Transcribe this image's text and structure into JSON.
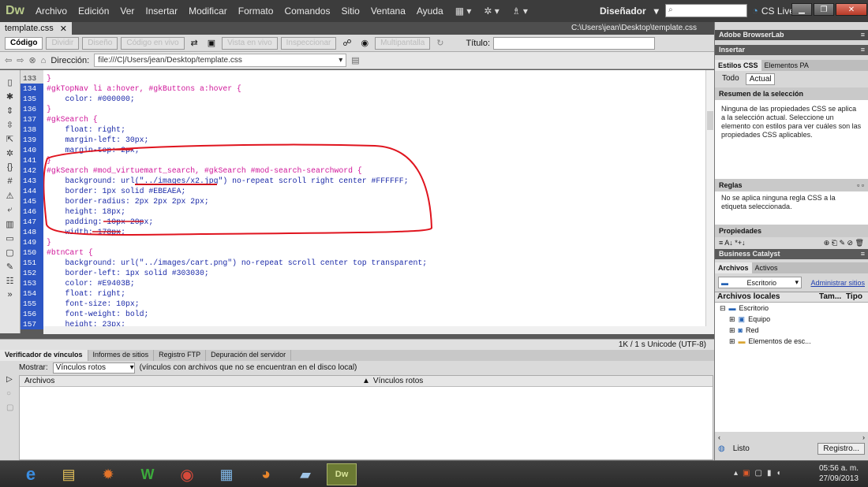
{
  "menubar": {
    "logo": "Dw",
    "items": [
      "Archivo",
      "Edición",
      "Ver",
      "Insertar",
      "Modificar",
      "Formato",
      "Comandos",
      "Sitio",
      "Ventana",
      "Ayuda"
    ],
    "workspace": "Diseñador",
    "cslive": "CS Live"
  },
  "document": {
    "tab_label": "template.css",
    "path": "C:\\Users\\jean\\Desktop\\template.css",
    "view_buttons": [
      "Código",
      "Dividir",
      "Diseño",
      "Código en vivo",
      "Vista en vivo",
      "Inspeccionar",
      "Multipantalla"
    ],
    "title_label": "Título:",
    "address_label": "Dirección:",
    "address_value": "file:///C|/Users/jean/Desktop/template.css",
    "status": "1K / 1 s  Unicode (UTF-8)"
  },
  "code": {
    "lines": [
      {
        "n": "133",
        "t": "}",
        "c": "sel"
      },
      {
        "n": "134",
        "t": "#gkTopNav li a:hover, #gkButtons a:hover {",
        "c": "sel"
      },
      {
        "n": "135",
        "t": "    color: #000000;",
        "c": "prop"
      },
      {
        "n": "136",
        "t": "}",
        "c": "sel"
      },
      {
        "n": "137",
        "t": "#gkSearch {",
        "c": "sel"
      },
      {
        "n": "138",
        "t": "    float: right;",
        "c": "prop"
      },
      {
        "n": "139",
        "t": "    margin-left: 30px;",
        "c": "prop"
      },
      {
        "n": "140",
        "t": "    margin-top: 2px;",
        "c": "prop"
      },
      {
        "n": "141",
        "t": "}",
        "c": "sel"
      },
      {
        "n": "142",
        "t": "#gkSearch #mod_virtuemart_search, #gkSearch #mod-search-searchword {",
        "c": "sel"
      },
      {
        "n": "143",
        "t": "    background: url(\"../images/x2.jpg\") no-repeat scroll right center #FFFFFF;",
        "c": "prop"
      },
      {
        "n": "144",
        "t": "    border: 1px solid #EBEAEA;",
        "c": "prop"
      },
      {
        "n": "145",
        "t": "    border-radius: 2px 2px 2px 2px;",
        "c": "prop"
      },
      {
        "n": "146",
        "t": "    height: 18px;",
        "c": "prop"
      },
      {
        "n": "147",
        "t": "    padding: 10px 20px;",
        "c": "prop"
      },
      {
        "n": "148",
        "t": "    width: 178px;",
        "c": "prop"
      },
      {
        "n": "149",
        "t": "}",
        "c": "sel"
      },
      {
        "n": "150",
        "t": "#btnCart {",
        "c": "sel"
      },
      {
        "n": "151",
        "t": "    background: url(\"../images/cart.png\") no-repeat scroll center top transparent;",
        "c": "prop"
      },
      {
        "n": "152",
        "t": "    border-left: 1px solid #303030;",
        "c": "prop"
      },
      {
        "n": "153",
        "t": "    color: #E9403B;",
        "c": "prop"
      },
      {
        "n": "154",
        "t": "    float: right;",
        "c": "prop"
      },
      {
        "n": "155",
        "t": "    font-size: 10px;",
        "c": "prop"
      },
      {
        "n": "156",
        "t": "    font-weight: bold;",
        "c": "prop"
      },
      {
        "n": "157",
        "t": "    height: 23px;",
        "c": "prop"
      }
    ]
  },
  "bottom_panel": {
    "tabs": [
      "Verificador de vínculos",
      "Informes de sitios",
      "Registro FTP",
      "Depuración del servidor"
    ],
    "show_label": "Mostrar:",
    "show_value": "Vínculos rotos",
    "show_hint": "(vínculos con archivos que no se encuentran en el disco local)",
    "col_files": "Archivos",
    "col_links": "Vínculos rotos"
  },
  "right_panel": {
    "browserlab": "Adobe BrowserLab",
    "insert": "Insertar",
    "css_tabs": [
      "Estilos CSS",
      "Elementos PA"
    ],
    "mode_tabs": [
      "Todo",
      "Actual"
    ],
    "summary_title": "Resumen de la selección",
    "summary_text": "Ninguna de las propiedades CSS se aplica a la selección actual.  Seleccione un elemento con estilos para ver cuáles son las propiedades CSS aplicables.",
    "rules_title": "Reglas",
    "rules_text": "No se aplica ninguna regla CSS a la etiqueta seleccionada.",
    "props_title": "Propiedades",
    "business": "Business Catalyst",
    "files_tabs": [
      "Archivos",
      "Activos"
    ],
    "site_select": "Escritorio",
    "manage_link": "Administrar sitios",
    "files_col1": "Archivos locales",
    "files_col2": "Tam...",
    "files_col3": "Tipo",
    "tree": [
      "Escritorio",
      "Equipo",
      "Red",
      "Elementos de esc..."
    ],
    "status": "Listo",
    "log_button": "Registro..."
  },
  "taskbar": {
    "time": "05:56 a. m.",
    "date": "27/09/2013",
    "dw_label": "Dw"
  }
}
